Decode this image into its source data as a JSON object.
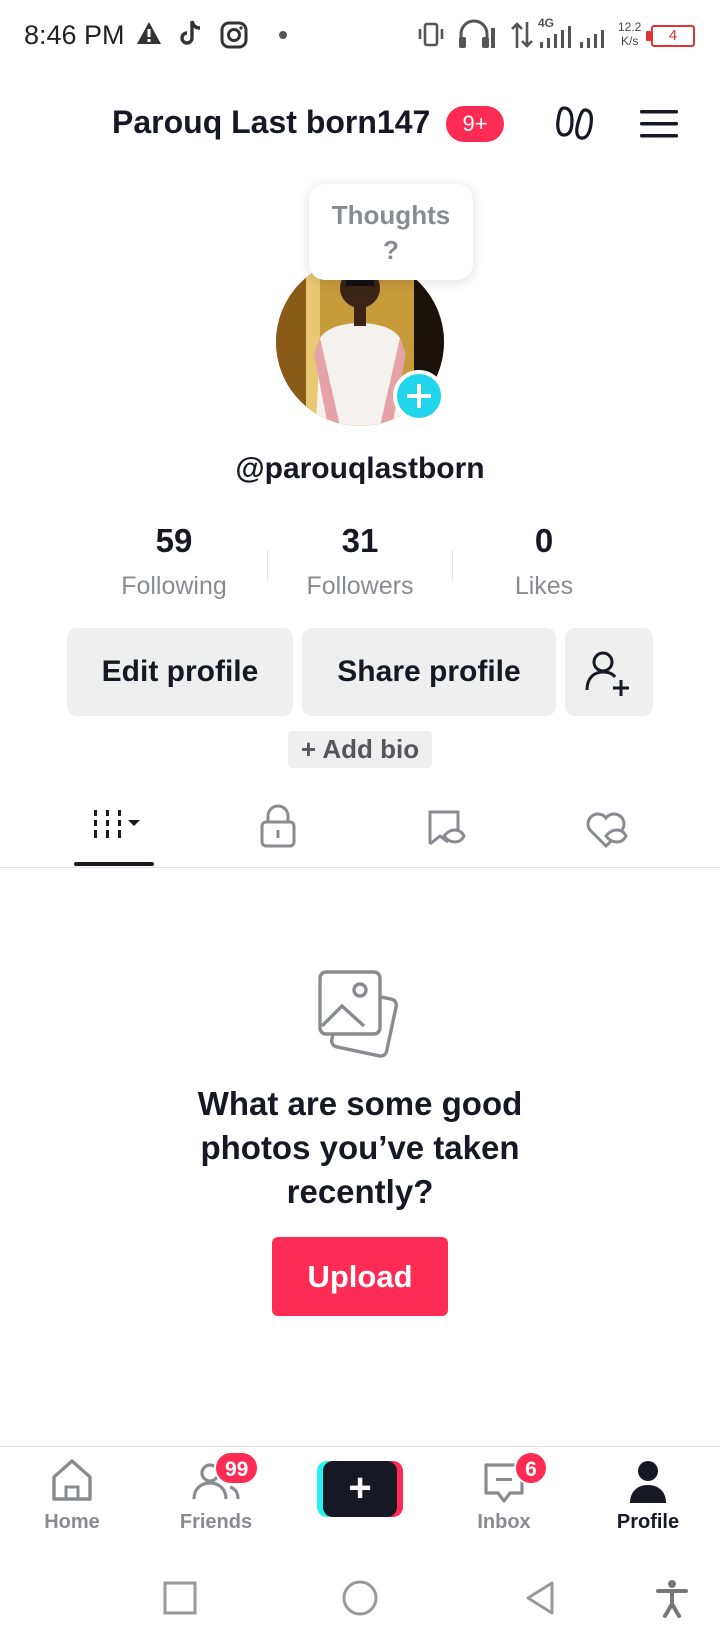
{
  "status_bar": {
    "time": "8:46 PM",
    "net_speed_value": "12.2",
    "net_speed_unit": "K/s",
    "network_label": "4G",
    "battery_level": "4",
    "icons": [
      "warning-icon",
      "tiktok-icon",
      "instagram-icon",
      "dot-icon",
      "vibrate-icon",
      "headphones-icon",
      "data-arrows-icon",
      "signal-icon",
      "signal-icon",
      "battery-icon"
    ]
  },
  "header": {
    "username": "Parouq Last born147",
    "notification_badge": "9+",
    "icons": [
      "footprints-icon",
      "menu-icon"
    ]
  },
  "tooltip": {
    "line1": "Thoughts",
    "line2": "?"
  },
  "profile": {
    "handle": "@parouqlastborn",
    "avatar_add_icon": "plus-icon"
  },
  "stats": [
    {
      "value": "59",
      "label": "Following"
    },
    {
      "value": "31",
      "label": "Followers"
    },
    {
      "value": "0",
      "label": "Likes"
    }
  ],
  "actions": {
    "edit_profile": "Edit profile",
    "share_profile": "Share profile",
    "add_friend_icon": "add-user-icon",
    "add_bio": "+ Add bio"
  },
  "tabs": [
    {
      "icon": "grid-icon",
      "active": true
    },
    {
      "icon": "lock-icon",
      "active": false
    },
    {
      "icon": "repost-icon",
      "active": false
    },
    {
      "icon": "liked-icon",
      "active": false
    }
  ],
  "empty_state": {
    "icon": "photos-icon",
    "title": "What are some good photos you’ve taken recently?",
    "button": "Upload"
  },
  "bottom_nav": {
    "items": [
      {
        "label": "Home",
        "icon": "home-icon"
      },
      {
        "label": "Friends",
        "icon": "friends-icon",
        "badge": "99"
      },
      {
        "label": "",
        "icon": "create-icon"
      },
      {
        "label": "Inbox",
        "icon": "inbox-icon",
        "badge": "6"
      },
      {
        "label": "Profile",
        "icon": "profile-icon",
        "active": true
      }
    ]
  },
  "colors": {
    "accent": "#fe2c55",
    "cyan": "#25f4ee",
    "avatar_plus": "#20d5ec",
    "text": "#161823",
    "muted": "#8a8b91"
  }
}
